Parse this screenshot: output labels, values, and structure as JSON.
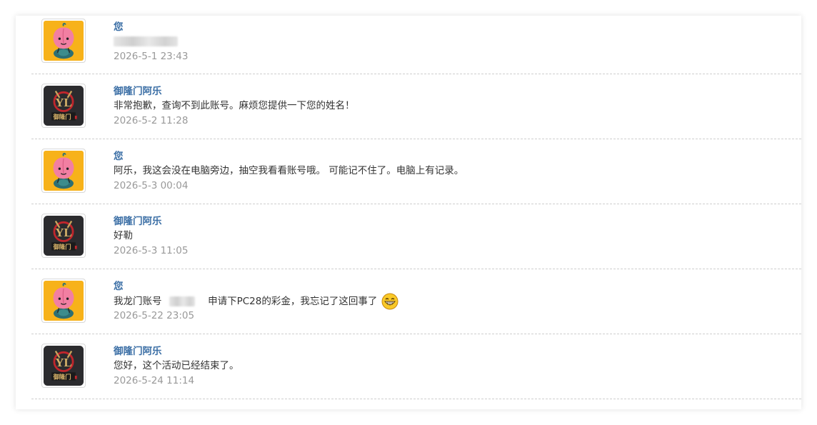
{
  "messages": [
    {
      "sender": "您",
      "avatar": "peach-avatar-icon",
      "text_prefix": "",
      "text_suffix": "",
      "time": "2026-5-1 23:43"
    },
    {
      "sender": "御隆门阿乐",
      "avatar": "ylm-logo-avatar-icon",
      "text": "非常抱歉，查询不到此账号。麻烦您提供一下您的姓名！",
      "time": "2026-5-2 11:28"
    },
    {
      "sender": "您",
      "avatar": "peach-avatar-icon",
      "text": "阿乐，我这会没在电脑旁边，抽空我看看账号哦。 可能记不住了。电脑上有记录。",
      "time": "2026-5-3 00:04"
    },
    {
      "sender": "御隆门阿乐",
      "avatar": "ylm-logo-avatar-icon",
      "text": "好勒",
      "time": "2026-5-3 11:05"
    },
    {
      "sender": "您",
      "avatar": "peach-avatar-icon",
      "text_prefix": "我龙门账号",
      "text_suffix": "申请下PC28的彩金，我忘记了这回事了",
      "emoji": "grinning-face-icon",
      "time": "2026-5-22 23:05"
    },
    {
      "sender": "御隆门阿乐",
      "avatar": "ylm-logo-avatar-icon",
      "text": "您好，这个活动已经结束了。",
      "time": "2026-5-24 11:14"
    }
  ],
  "colors": {
    "sender_name": "#3a6ea5",
    "message_text": "#333333",
    "timestamp": "#999999",
    "divider": "#cfcfcf",
    "peach_bg": "#f7b21a",
    "logo_bg": "#2b2b2e"
  }
}
